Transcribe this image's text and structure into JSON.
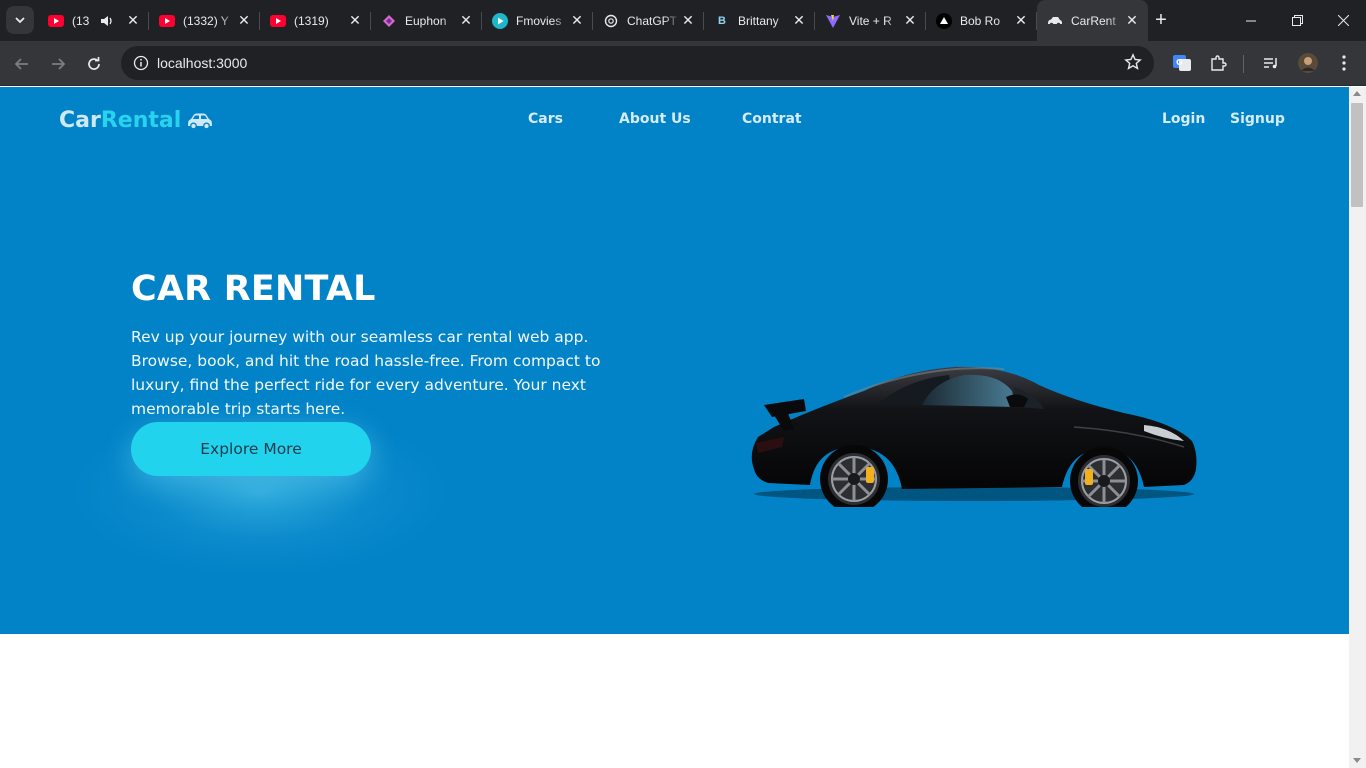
{
  "browser": {
    "tabs": [
      {
        "title": "(13",
        "favicon": "youtube-icon",
        "audio": true
      },
      {
        "title": "(1332) Y",
        "favicon": "youtube-icon"
      },
      {
        "title": "(1319)",
        "favicon": "youtube-icon"
      },
      {
        "title": "Euphon",
        "favicon": "euphoria-icon"
      },
      {
        "title": "Fmovies",
        "favicon": "fmovies-icon"
      },
      {
        "title": "ChatGPT",
        "favicon": "chatgpt-icon"
      },
      {
        "title": "Brittany",
        "favicon": "letter-b-icon"
      },
      {
        "title": "Vite + R",
        "favicon": "vite-icon"
      },
      {
        "title": "Bob Ro",
        "favicon": "triangle-icon"
      },
      {
        "title": "CarRent",
        "favicon": "car-icon",
        "active": true
      }
    ],
    "url": "localhost:3000"
  },
  "site": {
    "logo": {
      "part1": "Car",
      "part2": "Rental",
      "icon": "car-icon"
    },
    "nav": {
      "cars": "Cars",
      "about": "About Us",
      "contract": "Contrat"
    },
    "auth": {
      "login": "Login",
      "signup": "Signup"
    },
    "hero": {
      "title": "CAR RENTAL",
      "description": "Rev up your journey with our seamless car rental web app. Browse, book, and hit the road hassle-free. From compact to luxury, find the perfect ride for every adventure. Your next memorable trip starts here.",
      "button": "Explore More"
    }
  },
  "colors": {
    "hero_bg": "#0283c7",
    "accent": "#22d3ee",
    "chrome_dark": "#202124",
    "chrome_toolbar": "#35363a"
  }
}
